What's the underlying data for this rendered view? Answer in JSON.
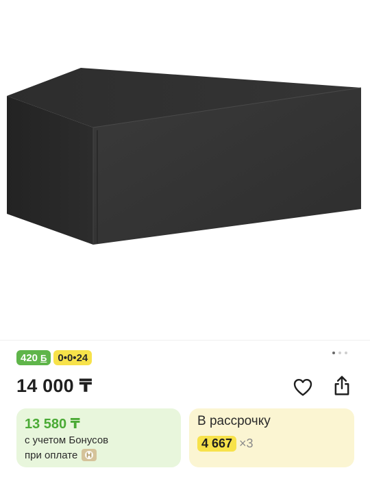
{
  "badges": {
    "bonus_value": "420",
    "bonus_symbol": "Б",
    "installment_label": "0•0•24"
  },
  "gallery": {
    "total_images": 3,
    "active_index": 0
  },
  "product": {
    "price": "14 000 ₸"
  },
  "bonus_card": {
    "price": "13 580 ₸",
    "line1": "с учетом Бонусов",
    "line2": "при оплате"
  },
  "installment_card": {
    "title": "В рассрочку",
    "amount": "4 667",
    "multiplier": "×3"
  },
  "icons": {
    "favorite": "heart-icon",
    "share": "share-icon",
    "bank": "bank-logo-icon"
  },
  "colors": {
    "bonus_green": "#5fb54a",
    "installment_yellow": "#f7e24a",
    "bonus_card_bg": "#e8f6dc",
    "installment_card_bg": "#fbf5d2"
  }
}
